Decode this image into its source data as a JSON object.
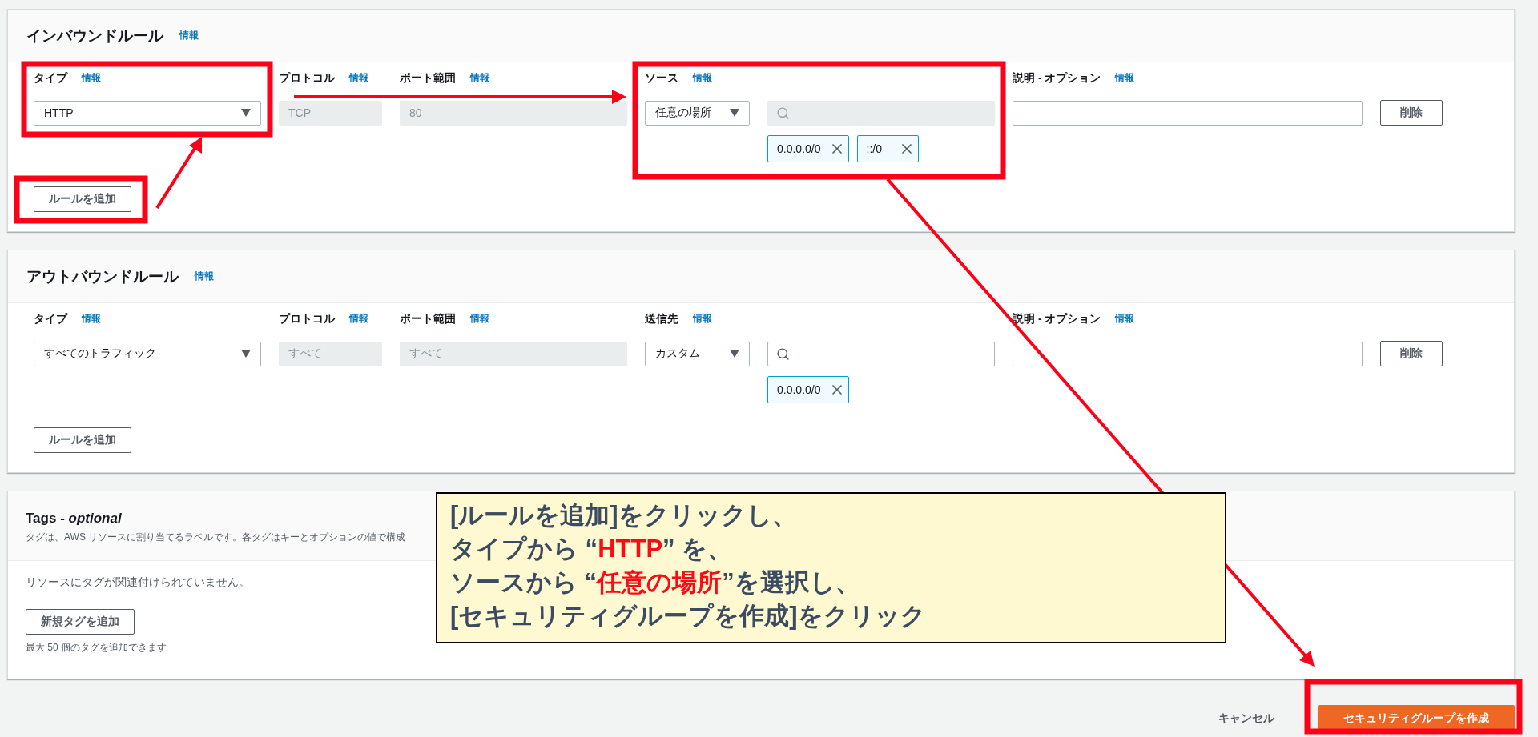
{
  "inbound_rules": {
    "title": "インバウンドルール",
    "info": "情報",
    "columns": [
      {
        "label": "タイプ",
        "info": "情報"
      },
      {
        "label": "プロトコル",
        "info": "情報"
      },
      {
        "label": "ポート範囲",
        "info": "情報"
      },
      {
        "label": "ソース",
        "info": "情報"
      },
      {
        "label": "説明 - オプション",
        "info": "情報"
      }
    ],
    "rules": [
      {
        "type": "HTTP",
        "protocol": "TCP",
        "port_range": "80",
        "source": "任意の場所",
        "search_disabled": true,
        "chips": [
          "0.0.0.0/0",
          "::/0"
        ],
        "delete": "削除"
      }
    ],
    "add_button": "ルールを追加"
  },
  "outbound_rules": {
    "title": "アウトバウンドルール",
    "info": "情報",
    "columns": [
      {
        "label": "タイプ",
        "info": "情報"
      },
      {
        "label": "プロトコル",
        "info": "情報"
      },
      {
        "label": "ポート範囲",
        "info": "情報"
      },
      {
        "label": "送信先",
        "info": "情報"
      },
      {
        "label": "説明 - オプション",
        "info": "情報"
      }
    ],
    "rules": [
      {
        "type": "すべてのトラフィック",
        "protocol": "すべて",
        "port_range": "すべて",
        "source": "カスタム",
        "search_disabled": false,
        "chips": [
          "0.0.0.0/0"
        ],
        "delete": "削除"
      }
    ],
    "add_button": "ルールを追加"
  },
  "tags": {
    "title": "Tags - *optional*",
    "description": "タグは、AWS リソースに割り当てるラベルです。各タグはキーとオプションの値で構成",
    "empty_text": "リソースにタグが関連付けられていません。",
    "add_button": "新規タグを追加",
    "limit_text": "最大 50 個のタグを追加できます"
  },
  "footer": {
    "cancel": "キャンセル",
    "create": "セキュリティグループを作成"
  },
  "annotation": {
    "lines": [
      [
        {
          "text": "[ルールを追加]をクリックし、",
          "highlight": false
        }
      ],
      [
        {
          "text": "タイプから “",
          "highlight": false
        },
        {
          "text": "HTTP",
          "highlight": true
        },
        {
          "text": "”  を、",
          "highlight": false
        }
      ],
      [
        {
          "text": "ソースから “",
          "highlight": false
        },
        {
          "text": "任意の場所",
          "highlight": true
        },
        {
          "text": "”を選択し、",
          "highlight": false
        }
      ],
      [
        {
          "text": "[セキュリティグループを作成]をクリック",
          "highlight": false
        }
      ]
    ]
  }
}
